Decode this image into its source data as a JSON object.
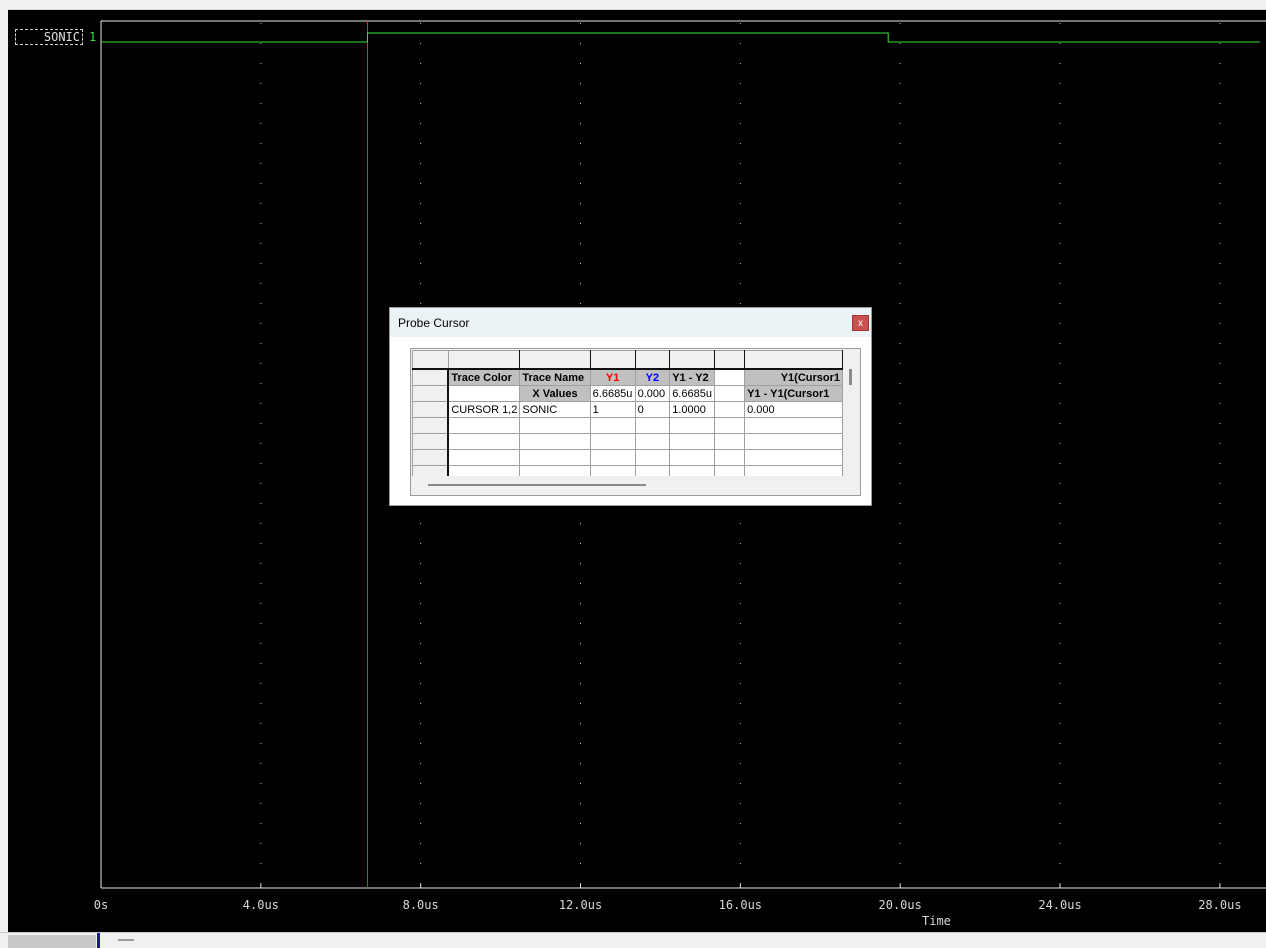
{
  "chart_data": {
    "type": "line",
    "title": "",
    "xlabel": "Time",
    "ylabel": "",
    "x_unit": "us",
    "xlim": [
      0,
      29.0
    ],
    "x_ticks": [
      0,
      4,
      8,
      12,
      16,
      20,
      24,
      28
    ],
    "x_tick_labels": [
      "0s",
      "4.0us",
      "8.0us",
      "12.0us",
      "16.0us",
      "20.0us",
      "24.0us",
      "28.0us"
    ],
    "grid": true,
    "background": "#000000",
    "series": [
      {
        "name": "SONIC",
        "level_label": "1",
        "color": "#3be03b",
        "points": [
          [
            0,
            0
          ],
          [
            6.67,
            0
          ],
          [
            6.67,
            1
          ],
          [
            19.7,
            1
          ],
          [
            19.7,
            0
          ],
          [
            29.0,
            0
          ]
        ]
      }
    ],
    "cursors": [
      {
        "name": "Y1",
        "x": 6.6685,
        "color": "#ff2020"
      }
    ]
  },
  "probe_cursor": {
    "title": "Probe Cursor",
    "close_label": "x",
    "header_row": {
      "trace_color": "Trace Color",
      "trace_name": "Trace Name",
      "y1": "Y1",
      "y2": "Y2",
      "y1_minus_y2": "Y1 - Y2",
      "y1_cursor1": "Y1(Cursor1"
    },
    "xvalues_row": {
      "label": "X Values",
      "y1": "6.6685u",
      "y2": "0.000",
      "y1_minus_y2": "6.6685u",
      "y1_cursor1": "Y1 - Y1(Cursor1"
    },
    "data_row": {
      "trace_color": "CURSOR 1,2",
      "trace_name": "SONIC",
      "y1": "1",
      "y2": "0",
      "y1_minus_y2": "1.0000",
      "y1_cursor1": "0.000"
    }
  }
}
